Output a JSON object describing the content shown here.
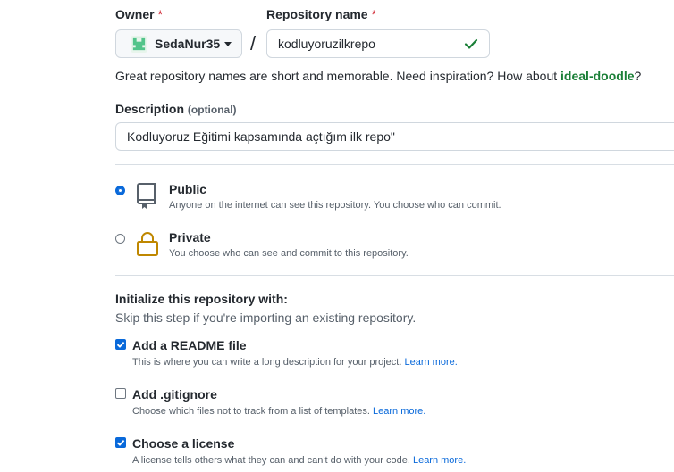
{
  "owner": {
    "label": "Owner",
    "required_mark": "*",
    "value": "SedaNur35"
  },
  "repo_name": {
    "label": "Repository name",
    "required_mark": "*",
    "value": "kodluyoruzilkrepo",
    "separator": "/"
  },
  "name_hint": {
    "text": "Great repository names are short and memorable. Need inspiration? How about ",
    "suggestion": "ideal-doodle",
    "end": "?"
  },
  "description": {
    "label": "Description",
    "optional": "(optional)",
    "value": "Kodluyoruz Eğitimi kapsamında açtığım ilk repo\""
  },
  "visibility": [
    {
      "title": "Public",
      "desc": "Anyone on the internet can see this repository. You choose who can commit.",
      "checked": true
    },
    {
      "title": "Private",
      "desc": "You choose who can see and commit to this repository.",
      "checked": false
    }
  ],
  "init": {
    "title": "Initialize this repository with:",
    "subtitle": "Skip this step if you're importing an existing repository.",
    "options": [
      {
        "title": "Add a README file",
        "desc": "This is where you can write a long description for your project.",
        "link": "Learn more.",
        "checked": true
      },
      {
        "title": "Add .gitignore",
        "desc": "Choose which files not to track from a list of templates.",
        "link": "Learn more.",
        "checked": false
      },
      {
        "title": "Choose a license",
        "desc": "A license tells others what they can and can't do with your code.",
        "link": "Learn more.",
        "checked": true
      }
    ]
  },
  "colors": {
    "accent": "#0969da",
    "success": "#1a7f37",
    "danger": "#cf222e",
    "private_icon": "#bf8700"
  }
}
